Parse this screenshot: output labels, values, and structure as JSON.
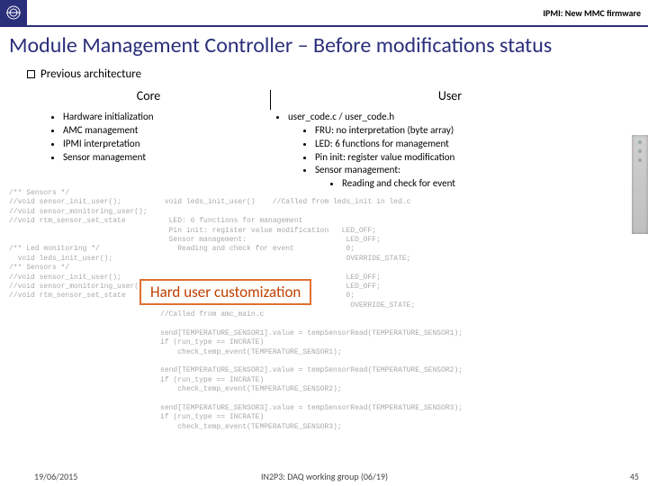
{
  "header": {
    "text": "IPMI: New MMC firmware"
  },
  "title": "Module Management Controller – Before modifications status",
  "section": "Previous architecture",
  "colLeftTitle": "Core",
  "colRightTitle": "User",
  "core": {
    "i0": "Hardware initialization",
    "i1": "AMC management",
    "i2": "IPMI interpretation",
    "i3": "Sensor management"
  },
  "user": {
    "root": "user_code.c / user_code.h",
    "a": "FRU: no interpretation (byte array)",
    "b": "LED: 6 functions for management",
    "c": "Pin init: register value modification",
    "d": "Sensor management:",
    "d1": "Reading and check for event"
  },
  "callout": "Hard user customization",
  "footer": {
    "date": "19/06/2015",
    "group": "IN2P3: DAQ working group (06/19)",
    "page": "45"
  },
  "code": "/** Sensors */\n//void sensor_init_user();          void leds_init_user()    //Called from leds_init in led.c\n//void sensor_monitoring_user();\n//void rtm_sensor_set_state          LED: 6 functions for management\n                                     Pin init: register value modification   LED_OFF;\n                                     Sensor management:                       LED_OFF;\n/** Led monitoring */                  Reading and check for event            0;\n  void leds_init_user();                                                      OVERRIDE_STATE;\n/** Sensors */\n//void sensor_init_user();                                                    LED_OFF;\n//void sensor_monitoring_user();   Hard user customization                    LED_OFF;\n//void rtm_sensor_set_state                                                   0;\n                                                                               OVERRIDE_STATE;\n                                   //Called from amc_main.c\n\n                                   send[TEMPERATURE_SENSOR1].value = tempSensorRead(TEMPERATURE_SENSOR1);\n                                   if (run_type == INCRATE)\n                                       check_temp_event(TEMPERATURE_SENSOR1);\n\n                                   send[TEMPERATURE_SENSOR2].value = tempSensorRead(TEMPERATURE_SENSOR2);\n                                   if (run_type == INCRATE)\n                                       check_temp_event(TEMPERATURE_SENSOR2);\n\n                                   send[TEMPERATURE_SENSOR3].value = tempSensorRead(TEMPERATURE_SENSOR3);\n                                   if (run_type == INCRATE)\n                                       check_temp_event(TEMPERATURE_SENSOR3);"
}
